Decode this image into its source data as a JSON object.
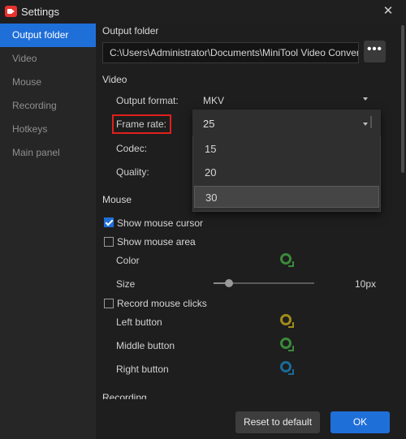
{
  "window": {
    "title": "Settings",
    "close_glyph": "✕"
  },
  "sidebar": {
    "items": [
      {
        "label": "Output folder"
      },
      {
        "label": "Video"
      },
      {
        "label": "Mouse"
      },
      {
        "label": "Recording"
      },
      {
        "label": "Hotkeys"
      },
      {
        "label": "Main panel"
      }
    ]
  },
  "output_folder": {
    "section_title": "Output folder",
    "path": "C:\\Users\\Administrator\\Documents\\MiniTool Video Converter",
    "browse_glyph": "•••"
  },
  "video": {
    "section_title": "Video",
    "output_format_label": "Output format:",
    "output_format_value": "MKV",
    "frame_rate_label": "Frame rate:",
    "codec_label": "Codec:",
    "quality_label": "Quality:"
  },
  "frame_rate_dropdown": {
    "selected": "25",
    "options": [
      "15",
      "20",
      "30"
    ],
    "hovered_option": "30"
  },
  "mouse": {
    "section_title": "Mouse",
    "show_cursor_label": "Show mouse cursor",
    "show_cursor_checked": true,
    "show_area_label": "Show mouse area",
    "show_area_checked": false,
    "color_label": "Color",
    "color_value": "#3a8a3a",
    "size_label": "Size",
    "size_value": "10px",
    "size_slider_fraction": 0.15,
    "record_clicks_label": "Record mouse clicks",
    "record_clicks_checked": false,
    "left_button_label": "Left button",
    "left_button_color": "#a08a1a",
    "middle_button_label": "Middle button",
    "middle_button_color": "#3a8a3a",
    "right_button_label": "Right button",
    "right_button_color": "#1a6a9a"
  },
  "recording": {
    "section_title": "Recording"
  },
  "footer": {
    "reset_label": "Reset to default",
    "ok_label": "OK"
  },
  "colors": {
    "accent": "#1f6fd8",
    "highlight_border": "#e0201c"
  }
}
